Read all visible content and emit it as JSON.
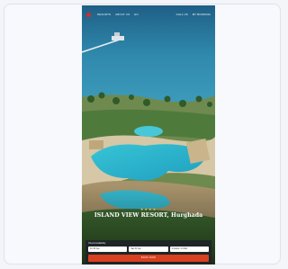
{
  "nav": {
    "links": [
      "RESORTS",
      "ABOUT US",
      "EN"
    ],
    "right_links": [
      "CALL US",
      "MY BOOKING"
    ]
  },
  "hero": {
    "stars": "★★★★",
    "hotel_name": "ISLAND VIEW RESORT, Hurghada"
  },
  "booking": {
    "title": "Check Availability",
    "fields": [
      "Fri 30 Jan",
      "Sat 31 Jan",
      "2 Adults, 0 Child"
    ],
    "button": "BOOK NOW"
  },
  "colors": {
    "brand": "#d62a2a",
    "button": "#d8401f",
    "sea": "#2a7ea0"
  }
}
